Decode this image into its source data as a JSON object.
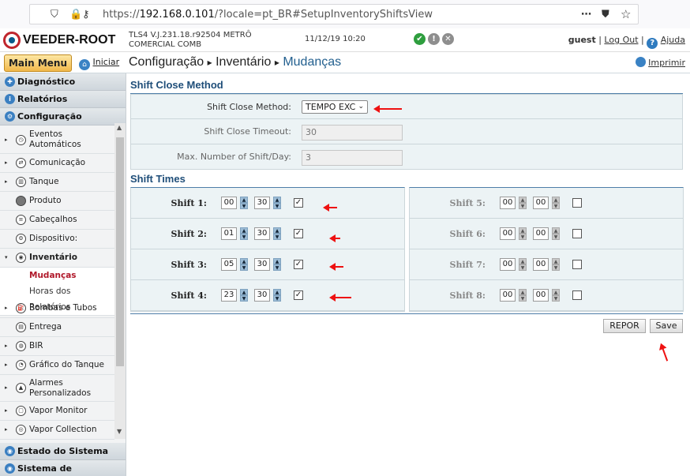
{
  "browser": {
    "url_prefix": "https://",
    "url_host": "192.168.0.101",
    "url_rest": "/?locale=pt_BR#SetupInventoryShiftsView",
    "menu_icon": "⋯",
    "pocket_icon": "pocket-icon",
    "star_icon": "☆"
  },
  "header": {
    "logo_text": "VEEDER-ROOT",
    "version_line1": "TLS4 V.J.231.18.r92504 METRÔ",
    "version_line2": "COMERCIAL COMB",
    "datetime": "11/12/19 10:20",
    "status_ok": "✔",
    "status_warn": "!",
    "status_alarm": "✕",
    "status_colors": {
      "ok": "#2e9e3e",
      "warn": "#8e8e8e",
      "alarm": "#8e8e8e"
    },
    "user": "guest",
    "logout": "Log Out",
    "help": "Ajuda",
    "help_icon": "?"
  },
  "crumbbar": {
    "main_menu": "Main Menu",
    "home": "Iniciar",
    "crumb1": "Configuração",
    "sep": "▸",
    "crumb2": "Inventário",
    "current": "Mudanças",
    "print": "Imprimir"
  },
  "sidebar": {
    "diagnostico": "Diagnóstico",
    "relatorios": "Relatórios",
    "configuracao": "Configuração",
    "items": [
      {
        "l1": "Eventos",
        "l2": "Automáticos"
      },
      {
        "l1": "Comunicação",
        "l2": ""
      },
      {
        "l1": "Tanque",
        "l2": ""
      },
      {
        "l1": "Produto",
        "l2": ""
      },
      {
        "l1": "Cabeçalhos",
        "l2": ""
      },
      {
        "l1": "Dispositivo:",
        "l2": ""
      },
      {
        "l1": "Inventário",
        "l2": ""
      }
    ],
    "sub_active": "Mudanças",
    "sub_other": "Horas dos Relatórios",
    "items2": [
      {
        "l1": "Bombas e Tubos",
        "l2": ""
      },
      {
        "l1": "Entrega",
        "l2": ""
      },
      {
        "l1": "BIR",
        "l2": ""
      },
      {
        "l1": "Gráfico do Tanque",
        "l2": ""
      },
      {
        "l1": "Alarmes",
        "l2": "Personalizados"
      },
      {
        "l1": "Vapor Monitor",
        "l2": ""
      },
      {
        "l1": "Vapor Collection",
        "l2": ""
      }
    ],
    "estado": "Estado do Sistema",
    "sistema": "Sistema de"
  },
  "shift_close": {
    "heading": "Shift Close Method",
    "method_label": "Shift Close Method:",
    "method_value": "TEMPO EXC",
    "timeout_label": "Shift Close Timeout:",
    "timeout_value": "30",
    "max_label": "Max. Number of Shift/Day:",
    "max_value": "3"
  },
  "shift_times": {
    "heading": "Shift Times",
    "left": [
      {
        "label": "Shift 1:",
        "hh": "00",
        "mm": "30",
        "checked": true
      },
      {
        "label": "Shift 2:",
        "hh": "01",
        "mm": "30",
        "checked": true
      },
      {
        "label": "Shift 3:",
        "hh": "05",
        "mm": "30",
        "checked": true
      },
      {
        "label": "Shift 4:",
        "hh": "23",
        "mm": "30",
        "checked": true
      }
    ],
    "right": [
      {
        "label": "Shift 5:",
        "hh": "00",
        "mm": "00",
        "checked": false
      },
      {
        "label": "Shift 6:",
        "hh": "00",
        "mm": "00",
        "checked": false
      },
      {
        "label": "Shift 7:",
        "hh": "00",
        "mm": "00",
        "checked": false
      },
      {
        "label": "Shift 8:",
        "hh": "00",
        "mm": "00",
        "checked": false
      }
    ]
  },
  "buttons": {
    "reset": "REPOR",
    "save": "Save"
  },
  "glyphs": {
    "up": "▲",
    "down": "▼",
    "check": "✓",
    "chev": "⌄",
    "tri_right": "▸",
    "tri_down": "▾"
  }
}
